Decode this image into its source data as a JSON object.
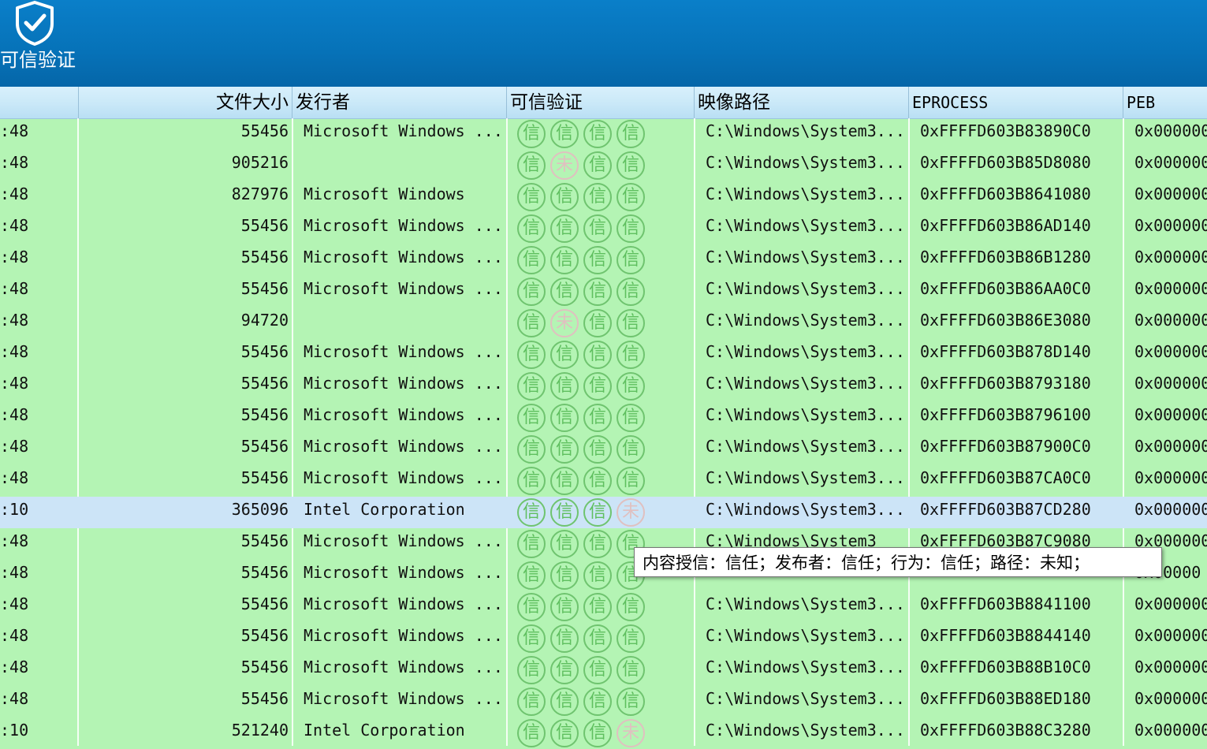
{
  "toolbar": {
    "trust_verify_label": "可信验证"
  },
  "columns": {
    "time": "",
    "size": "文件大小",
    "publisher": "发行者",
    "trust": "可信验证",
    "path": "映像路径",
    "eprocess": "EPROCESS",
    "peb": "PEB"
  },
  "badge_glyphs": {
    "trusted": "信",
    "untrusted": "未"
  },
  "colors": {
    "row_bg": "#b4f4b4",
    "selected_row_bg": "#cce4f7",
    "badge_green": "#6fc46f",
    "badge_off": "#e0c0c0",
    "toolbar_blue": "#0672b8"
  },
  "rows": [
    {
      "time": ":48",
      "size": "55456",
      "publisher": "Microsoft Windows ...",
      "trust": [
        1,
        1,
        1,
        1
      ],
      "path": "C:\\Windows\\System3...",
      "eprocess": "0xFFFFD603B83890C0",
      "peb": "0x000000"
    },
    {
      "time": ":48",
      "size": "905216",
      "publisher": "",
      "trust": [
        1,
        0,
        1,
        1
      ],
      "path": "C:\\Windows\\System3...",
      "eprocess": "0xFFFFD603B85D8080",
      "peb": "0x000000"
    },
    {
      "time": ":48",
      "size": "827976",
      "publisher": "Microsoft Windows",
      "trust": [
        1,
        1,
        1,
        1
      ],
      "path": "C:\\Windows\\System3...",
      "eprocess": "0xFFFFD603B8641080",
      "peb": "0x000000"
    },
    {
      "time": ":48",
      "size": "55456",
      "publisher": "Microsoft Windows ...",
      "trust": [
        1,
        1,
        1,
        1
      ],
      "path": "C:\\Windows\\System3...",
      "eprocess": "0xFFFFD603B86AD140",
      "peb": "0x000000"
    },
    {
      "time": ":48",
      "size": "55456",
      "publisher": "Microsoft Windows ...",
      "trust": [
        1,
        1,
        1,
        1
      ],
      "path": "C:\\Windows\\System3...",
      "eprocess": "0xFFFFD603B86B1280",
      "peb": "0x000000"
    },
    {
      "time": ":48",
      "size": "55456",
      "publisher": "Microsoft Windows ...",
      "trust": [
        1,
        1,
        1,
        1
      ],
      "path": "C:\\Windows\\System3...",
      "eprocess": "0xFFFFD603B86AA0C0",
      "peb": "0x000000"
    },
    {
      "time": ":48",
      "size": "94720",
      "publisher": "",
      "trust": [
        1,
        0,
        1,
        1
      ],
      "path": "C:\\Windows\\System3...",
      "eprocess": "0xFFFFD603B86E3080",
      "peb": "0x000000"
    },
    {
      "time": ":48",
      "size": "55456",
      "publisher": "Microsoft Windows ...",
      "trust": [
        1,
        1,
        1,
        1
      ],
      "path": "C:\\Windows\\System3...",
      "eprocess": "0xFFFFD603B878D140",
      "peb": "0x000000"
    },
    {
      "time": ":48",
      "size": "55456",
      "publisher": "Microsoft Windows ...",
      "trust": [
        1,
        1,
        1,
        1
      ],
      "path": "C:\\Windows\\System3...",
      "eprocess": "0xFFFFD603B8793180",
      "peb": "0x000000"
    },
    {
      "time": ":48",
      "size": "55456",
      "publisher": "Microsoft Windows ...",
      "trust": [
        1,
        1,
        1,
        1
      ],
      "path": "C:\\Windows\\System3...",
      "eprocess": "0xFFFFD603B8796100",
      "peb": "0x000000"
    },
    {
      "time": ":48",
      "size": "55456",
      "publisher": "Microsoft Windows ...",
      "trust": [
        1,
        1,
        1,
        1
      ],
      "path": "C:\\Windows\\System3...",
      "eprocess": "0xFFFFD603B87900C0",
      "peb": "0x000000"
    },
    {
      "time": ":48",
      "size": "55456",
      "publisher": "Microsoft Windows ...",
      "trust": [
        1,
        1,
        1,
        1
      ],
      "path": "C:\\Windows\\System3...",
      "eprocess": "0xFFFFD603B87CA0C0",
      "peb": "0x000000"
    },
    {
      "time": ":10",
      "size": "365096",
      "publisher": "Intel Corporation",
      "trust": [
        1,
        1,
        1,
        0
      ],
      "path": "C:\\Windows\\System3...",
      "eprocess": "0xFFFFD603B87CD280",
      "peb": "0x000000",
      "selected": true
    },
    {
      "time": ":48",
      "size": "55456",
      "publisher": "Microsoft Windows ...",
      "trust": [
        1,
        1,
        1,
        1
      ],
      "path": "C:\\Windows\\System3",
      "eprocess": "0xFFFFD603B87C9080",
      "peb": "0x000000"
    },
    {
      "time": ":48",
      "size": "55456",
      "publisher": "Microsoft Windows ...",
      "trust": [
        1,
        1,
        1,
        1
      ],
      "path": "",
      "eprocess": "",
      "peb": "0x00000"
    },
    {
      "time": ":48",
      "size": "55456",
      "publisher": "Microsoft Windows ...",
      "trust": [
        1,
        1,
        1,
        1
      ],
      "path": "C:\\Windows\\System3...",
      "eprocess": "0xFFFFD603B8841100",
      "peb": "0x000000"
    },
    {
      "time": ":48",
      "size": "55456",
      "publisher": "Microsoft Windows ...",
      "trust": [
        1,
        1,
        1,
        1
      ],
      "path": "C:\\Windows\\System3...",
      "eprocess": "0xFFFFD603B8844140",
      "peb": "0x000000"
    },
    {
      "time": ":48",
      "size": "55456",
      "publisher": "Microsoft Windows ...",
      "trust": [
        1,
        1,
        1,
        1
      ],
      "path": "C:\\Windows\\System3...",
      "eprocess": "0xFFFFD603B88B10C0",
      "peb": "0x000000"
    },
    {
      "time": ":48",
      "size": "55456",
      "publisher": "Microsoft Windows ...",
      "trust": [
        1,
        1,
        1,
        1
      ],
      "path": "C:\\Windows\\System3...",
      "eprocess": "0xFFFFD603B88ED180",
      "peb": "0x000000"
    },
    {
      "time": ":10",
      "size": "521240",
      "publisher": "Intel Corporation",
      "trust": [
        1,
        1,
        1,
        0
      ],
      "path": "C:\\Windows\\System3...",
      "eprocess": "0xFFFFD603B88C3280",
      "peb": "0x000000"
    }
  ],
  "tooltip": {
    "text": "内容授信：信任；发布者：信任；行为：信任；路径：未知；"
  }
}
